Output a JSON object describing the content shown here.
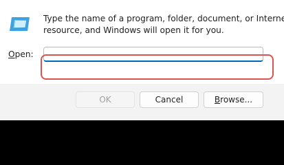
{
  "dialog": {
    "icon": "run-app-icon",
    "description_line1": "Type the name of a program, folder, document, or Internet",
    "description_line2": "resource, and Windows will open it for you.",
    "open_label_prefix": "O",
    "open_label_rest": "pen:",
    "open_input": {
      "value": "",
      "placeholder": ""
    }
  },
  "buttons": {
    "ok_label": "OK",
    "cancel_label": "Cancel",
    "browse_prefix": "B",
    "browse_rest": "rowse..."
  },
  "colors": {
    "accent": "#0067c0",
    "highlight": "#d9534f",
    "footer_bg": "#f3f3f3"
  }
}
